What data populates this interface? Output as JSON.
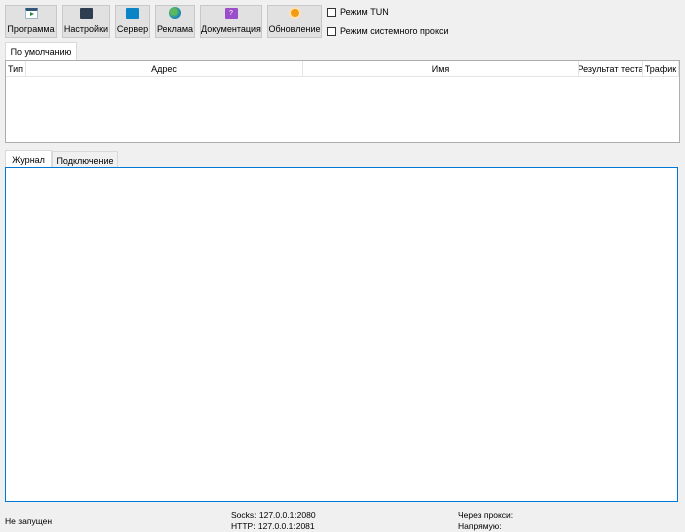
{
  "toolbar": {
    "buttons": [
      {
        "label": "Программа",
        "icon": "program-icon",
        "color": "#2b8a3e"
      },
      {
        "label": "Настройки",
        "icon": "settings-icon",
        "color": "#2d3e50"
      },
      {
        "label": "Сервер",
        "icon": "server-folder-icon",
        "color": "#0a84c6"
      },
      {
        "label": "Реклама",
        "icon": "globe-icon",
        "color": "#1e88b4"
      },
      {
        "label": "Документация",
        "icon": "help-icon",
        "color": "#9b4dca"
      },
      {
        "label": "Обновление",
        "icon": "update-icon",
        "color": "#f39c12"
      }
    ],
    "checkboxes": [
      {
        "label": "Режим TUN",
        "checked": false
      },
      {
        "label": "Режим системного прокси",
        "checked": false
      }
    ]
  },
  "server_tabs": [
    {
      "label": "По умолчанию",
      "active": true
    }
  ],
  "server_table": {
    "columns": [
      "Тип",
      "Адрес",
      "Имя",
      "Результат теста",
      "Трафик"
    ],
    "rows": []
  },
  "bottom_tabs": [
    {
      "label": "Журнал",
      "active": true
    },
    {
      "label": "Подключение",
      "active": false
    }
  ],
  "status": {
    "state": "Не запущен",
    "socks": "Socks: 127.0.0.1:2080",
    "http": "HTTP: 127.0.0.1:2081",
    "proxy": "Через прокси:",
    "direct": "Напрямую:"
  }
}
